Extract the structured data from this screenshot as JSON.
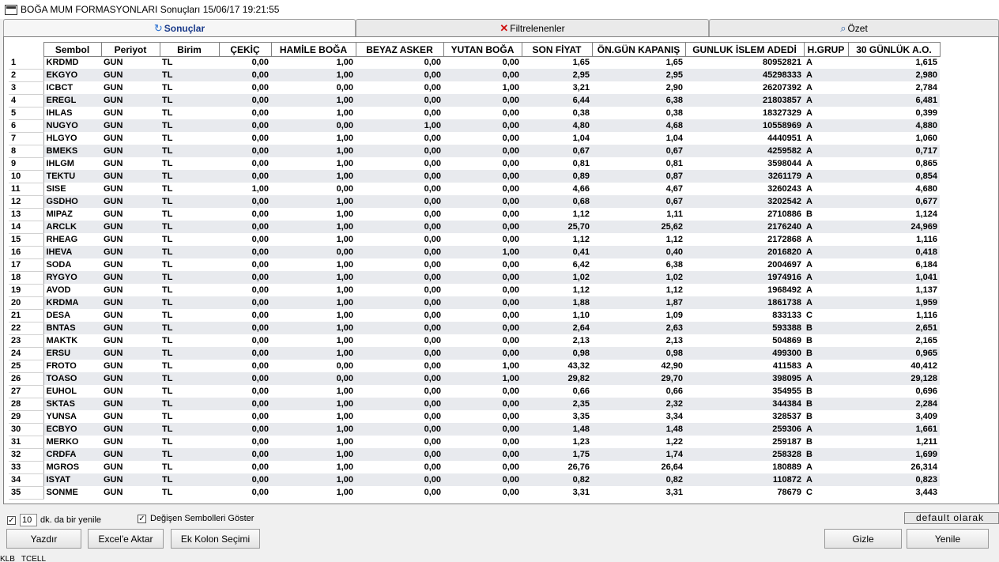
{
  "window": {
    "title": "BOĞA MUM FORMASYONLARI Sonuçları  15/06/17 19:21:55"
  },
  "tabs": [
    {
      "label": "Sonuçlar",
      "icon": "refresh-icon"
    },
    {
      "label": "Filtrelenenler",
      "icon": "close-x-icon"
    },
    {
      "label": "Özet",
      "icon": "search-doc-icon"
    }
  ],
  "table": {
    "columns": [
      "",
      "Sembol",
      "Periyot",
      "Birim",
      "ÇEKİÇ",
      "HAMİLE BOĞA",
      "BEYAZ ASKER",
      "YUTAN BOĞA",
      "SON FİYAT",
      "ÖN.GÜN KAPANIŞ",
      "GUNLUK İSLEM ADEDİ",
      "H.GRUP",
      "30 GÜNLÜK A.O."
    ],
    "rows": [
      [
        "1",
        "KRDMD",
        "GUN",
        "TL",
        "0,00",
        "1,00",
        "0,00",
        "0,00",
        "1,65",
        "1,65",
        "80952821",
        "A",
        "1,615"
      ],
      [
        "2",
        "EKGYO",
        "GUN",
        "TL",
        "0,00",
        "1,00",
        "0,00",
        "0,00",
        "2,95",
        "2,95",
        "45298333",
        "A",
        "2,980"
      ],
      [
        "3",
        "ICBCT",
        "GUN",
        "TL",
        "0,00",
        "0,00",
        "0,00",
        "1,00",
        "3,21",
        "2,90",
        "26207392",
        "A",
        "2,784"
      ],
      [
        "4",
        "EREGL",
        "GUN",
        "TL",
        "0,00",
        "1,00",
        "0,00",
        "0,00",
        "6,44",
        "6,38",
        "21803857",
        "A",
        "6,481"
      ],
      [
        "5",
        "IHLAS",
        "GUN",
        "TL",
        "0,00",
        "1,00",
        "0,00",
        "0,00",
        "0,38",
        "0,38",
        "18327329",
        "A",
        "0,399"
      ],
      [
        "6",
        "NUGYO",
        "GUN",
        "TL",
        "0,00",
        "0,00",
        "1,00",
        "0,00",
        "4,80",
        "4,68",
        "10558969",
        "A",
        "4,880"
      ],
      [
        "7",
        "HLGYO",
        "GUN",
        "TL",
        "0,00",
        "1,00",
        "0,00",
        "0,00",
        "1,04",
        "1,04",
        "4440951",
        "A",
        "1,060"
      ],
      [
        "8",
        "BMEKS",
        "GUN",
        "TL",
        "0,00",
        "1,00",
        "0,00",
        "0,00",
        "0,67",
        "0,67",
        "4259582",
        "A",
        "0,717"
      ],
      [
        "9",
        "IHLGM",
        "GUN",
        "TL",
        "0,00",
        "1,00",
        "0,00",
        "0,00",
        "0,81",
        "0,81",
        "3598044",
        "A",
        "0,865"
      ],
      [
        "10",
        "TEKTU",
        "GUN",
        "TL",
        "0,00",
        "1,00",
        "0,00",
        "0,00",
        "0,89",
        "0,87",
        "3261179",
        "A",
        "0,854"
      ],
      [
        "11",
        "SISE",
        "GUN",
        "TL",
        "1,00",
        "0,00",
        "0,00",
        "0,00",
        "4,66",
        "4,67",
        "3260243",
        "A",
        "4,680"
      ],
      [
        "12",
        "GSDHO",
        "GUN",
        "TL",
        "0,00",
        "1,00",
        "0,00",
        "0,00",
        "0,68",
        "0,67",
        "3202542",
        "A",
        "0,677"
      ],
      [
        "13",
        "MIPAZ",
        "GUN",
        "TL",
        "0,00",
        "1,00",
        "0,00",
        "0,00",
        "1,12",
        "1,11",
        "2710886",
        "B",
        "1,124"
      ],
      [
        "14",
        "ARCLK",
        "GUN",
        "TL",
        "0,00",
        "1,00",
        "0,00",
        "0,00",
        "25,70",
        "25,62",
        "2176240",
        "A",
        "24,969"
      ],
      [
        "15",
        "RHEAG",
        "GUN",
        "TL",
        "0,00",
        "1,00",
        "0,00",
        "0,00",
        "1,12",
        "1,12",
        "2172868",
        "A",
        "1,116"
      ],
      [
        "16",
        "IHEVA",
        "GUN",
        "TL",
        "0,00",
        "0,00",
        "0,00",
        "1,00",
        "0,41",
        "0,40",
        "2016820",
        "A",
        "0,418"
      ],
      [
        "17",
        "SODA",
        "GUN",
        "TL",
        "0,00",
        "1,00",
        "0,00",
        "0,00",
        "6,42",
        "6,38",
        "2004697",
        "A",
        "6,184"
      ],
      [
        "18",
        "RYGYO",
        "GUN",
        "TL",
        "0,00",
        "1,00",
        "0,00",
        "0,00",
        "1,02",
        "1,02",
        "1974916",
        "A",
        "1,041"
      ],
      [
        "19",
        "AVOD",
        "GUN",
        "TL",
        "0,00",
        "1,00",
        "0,00",
        "0,00",
        "1,12",
        "1,12",
        "1968492",
        "A",
        "1,137"
      ],
      [
        "20",
        "KRDMA",
        "GUN",
        "TL",
        "0,00",
        "1,00",
        "0,00",
        "0,00",
        "1,88",
        "1,87",
        "1861738",
        "A",
        "1,959"
      ],
      [
        "21",
        "DESA",
        "GUN",
        "TL",
        "0,00",
        "1,00",
        "0,00",
        "0,00",
        "1,10",
        "1,09",
        "833133",
        "C",
        "1,116"
      ],
      [
        "22",
        "BNTAS",
        "GUN",
        "TL",
        "0,00",
        "1,00",
        "0,00",
        "0,00",
        "2,64",
        "2,63",
        "593388",
        "B",
        "2,651"
      ],
      [
        "23",
        "MAKTK",
        "GUN",
        "TL",
        "0,00",
        "1,00",
        "0,00",
        "0,00",
        "2,13",
        "2,13",
        "504869",
        "B",
        "2,165"
      ],
      [
        "24",
        "ERSU",
        "GUN",
        "TL",
        "0,00",
        "1,00",
        "0,00",
        "0,00",
        "0,98",
        "0,98",
        "499300",
        "B",
        "0,965"
      ],
      [
        "25",
        "FROTO",
        "GUN",
        "TL",
        "0,00",
        "0,00",
        "0,00",
        "1,00",
        "43,32",
        "42,90",
        "411583",
        "A",
        "40,412"
      ],
      [
        "26",
        "TOASO",
        "GUN",
        "TL",
        "0,00",
        "0,00",
        "0,00",
        "1,00",
        "29,82",
        "29,70",
        "398095",
        "A",
        "29,128"
      ],
      [
        "27",
        "EUHOL",
        "GUN",
        "TL",
        "0,00",
        "1,00",
        "0,00",
        "0,00",
        "0,66",
        "0,66",
        "354955",
        "B",
        "0,696"
      ],
      [
        "28",
        "SKTAS",
        "GUN",
        "TL",
        "0,00",
        "1,00",
        "0,00",
        "0,00",
        "2,35",
        "2,32",
        "344384",
        "B",
        "2,284"
      ],
      [
        "29",
        "YUNSA",
        "GUN",
        "TL",
        "0,00",
        "1,00",
        "0,00",
        "0,00",
        "3,35",
        "3,34",
        "328537",
        "B",
        "3,409"
      ],
      [
        "30",
        "ECBYO",
        "GUN",
        "TL",
        "0,00",
        "1,00",
        "0,00",
        "0,00",
        "1,48",
        "1,48",
        "259306",
        "A",
        "1,661"
      ],
      [
        "31",
        "MERKO",
        "GUN",
        "TL",
        "0,00",
        "1,00",
        "0,00",
        "0,00",
        "1,23",
        "1,22",
        "259187",
        "B",
        "1,211"
      ],
      [
        "32",
        "CRDFA",
        "GUN",
        "TL",
        "0,00",
        "1,00",
        "0,00",
        "0,00",
        "1,75",
        "1,74",
        "258328",
        "B",
        "1,699"
      ],
      [
        "33",
        "MGROS",
        "GUN",
        "TL",
        "0,00",
        "1,00",
        "0,00",
        "0,00",
        "26,76",
        "26,64",
        "180889",
        "A",
        "26,314"
      ],
      [
        "34",
        "ISYAT",
        "GUN",
        "TL",
        "0,00",
        "1,00",
        "0,00",
        "0,00",
        "0,82",
        "0,82",
        "110872",
        "A",
        "0,823"
      ],
      [
        "35",
        "SONME",
        "GUN",
        "TL",
        "0,00",
        "1,00",
        "0,00",
        "0,00",
        "3,31",
        "3,31",
        "78679",
        "C",
        "3,443"
      ]
    ]
  },
  "bottom": {
    "refresh_checked": true,
    "refresh_minutes": "10",
    "refresh_label": "dk. da bir yenile",
    "show_changed_checked": true,
    "show_changed_label": "Değişen Sembolleri Göster",
    "default_label": "default olarak",
    "print_button": "Yazdır",
    "excel_button": "Excel'e Aktar",
    "extra_column_button": "Ek Kolon Seçimi",
    "hide_button": "Gizle",
    "refresh_button": "Yenile"
  },
  "statusbar": {
    "items": [
      "KLB",
      "TCELL"
    ]
  }
}
